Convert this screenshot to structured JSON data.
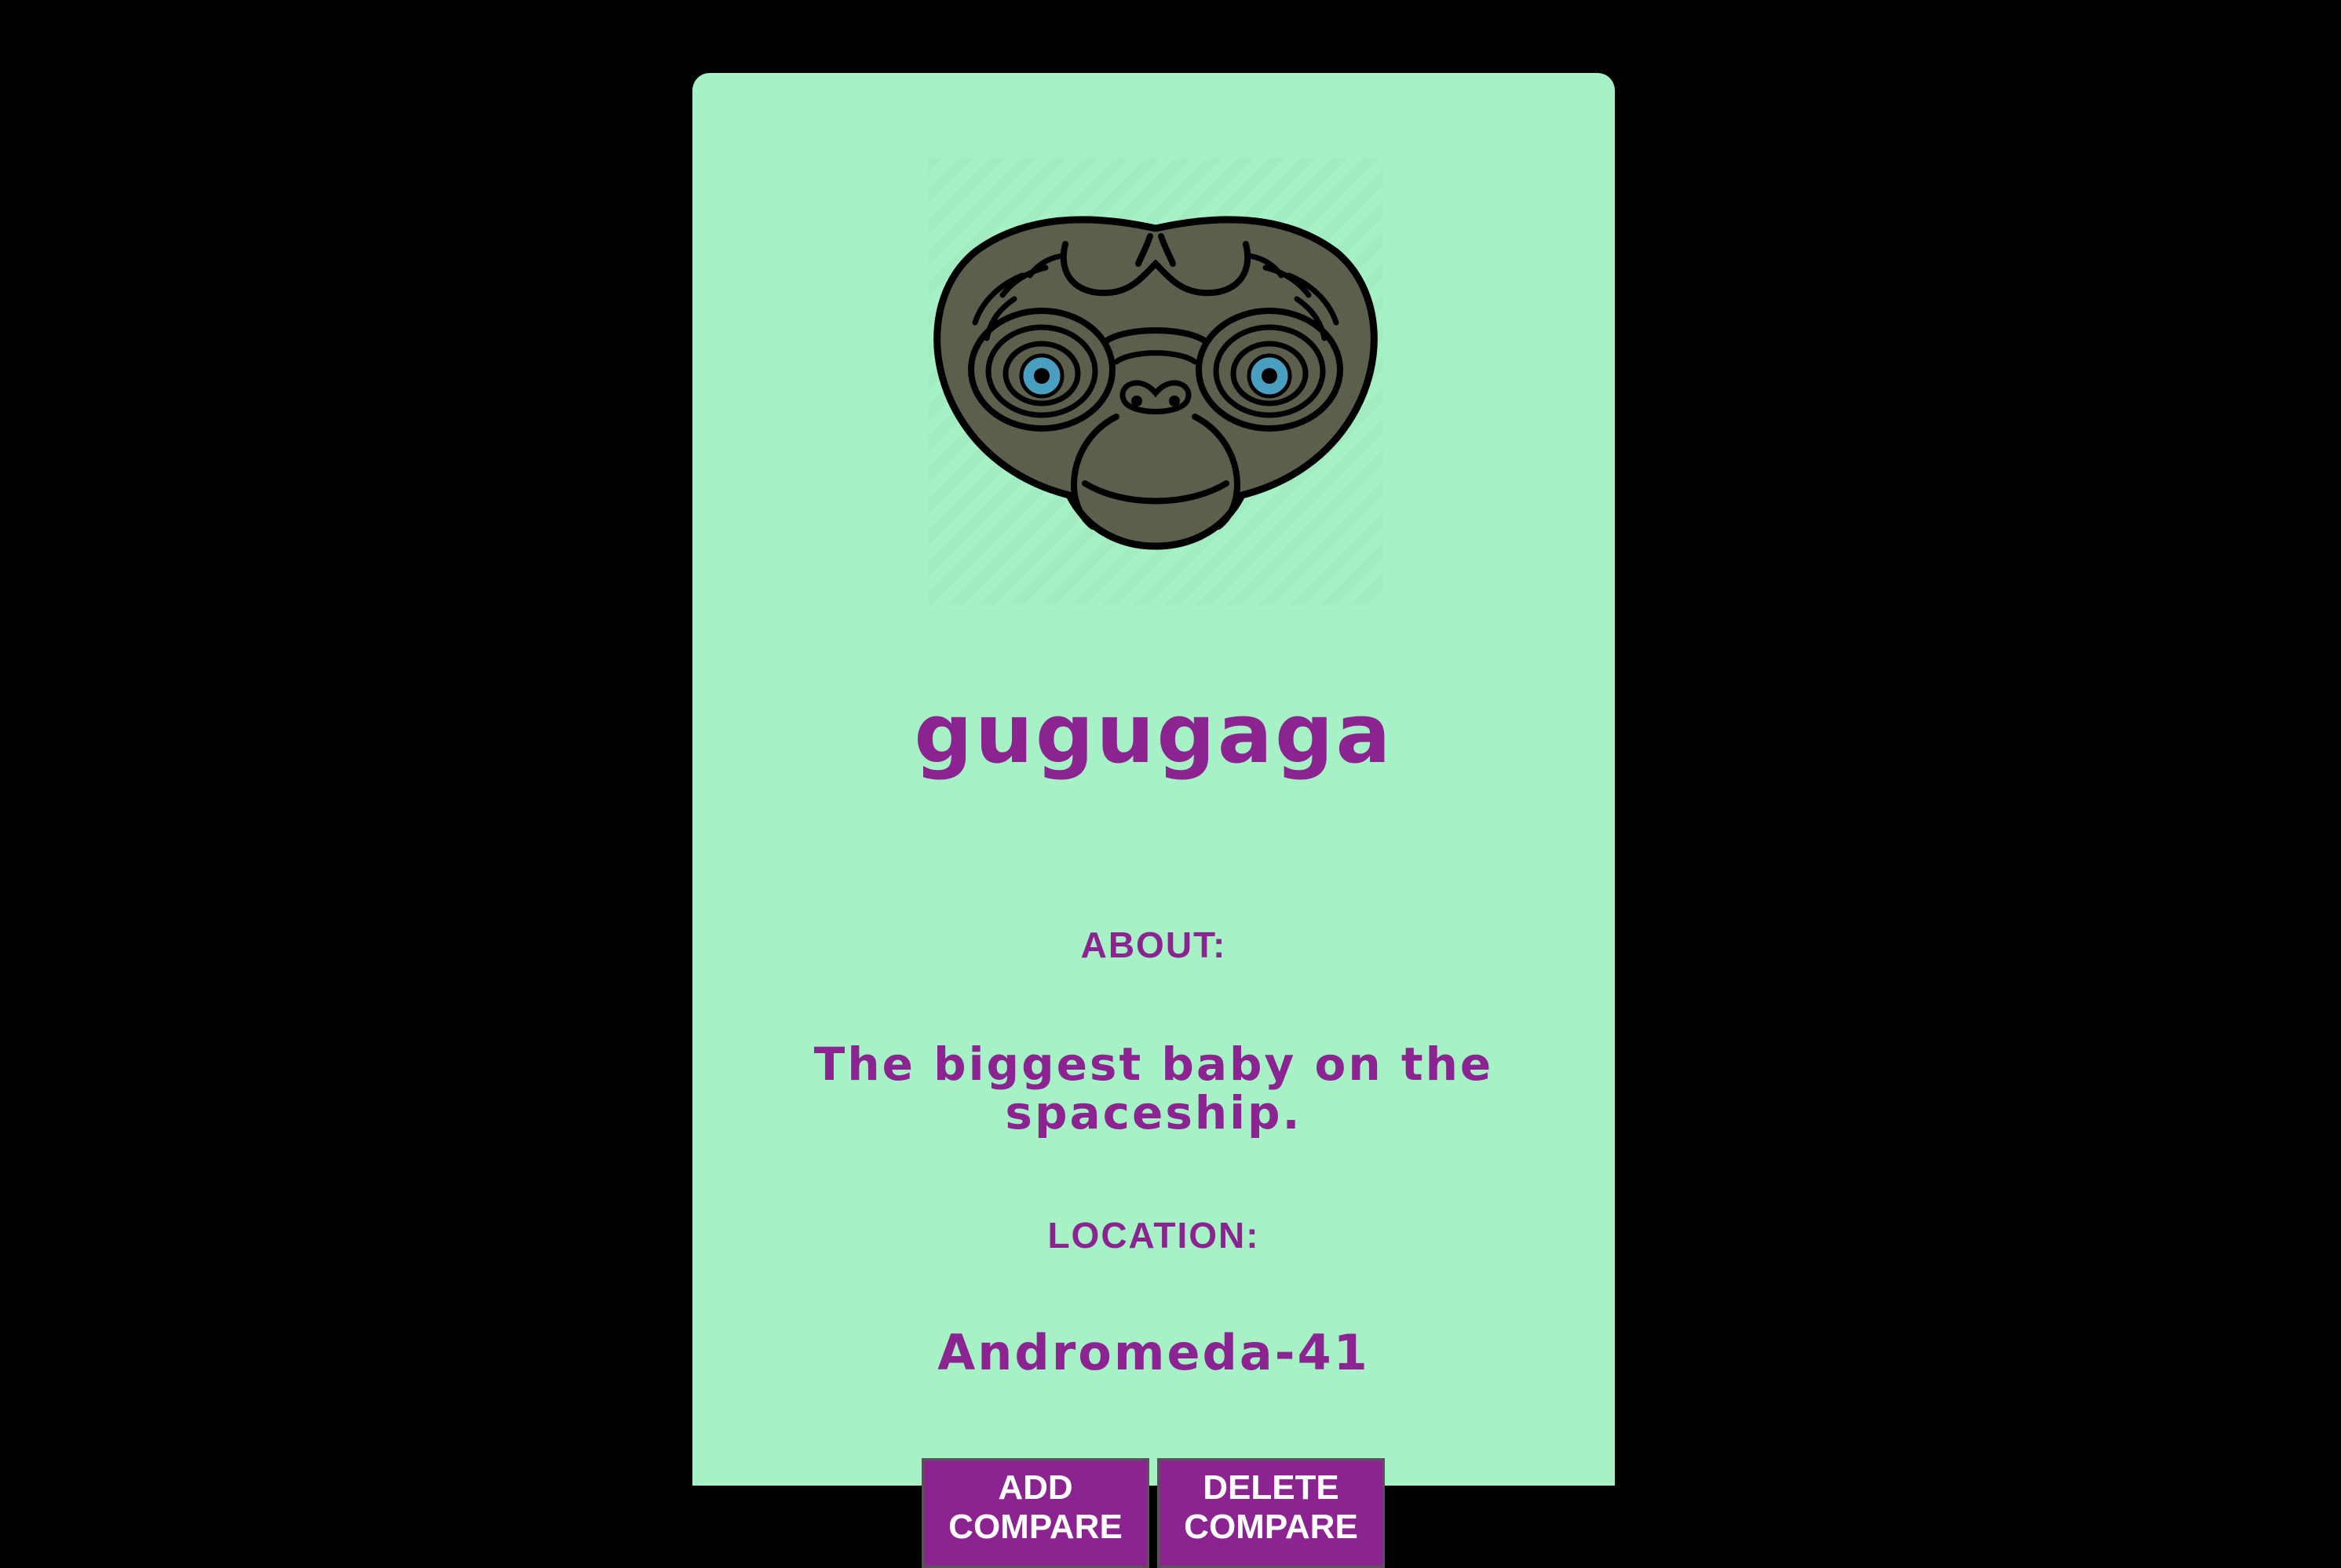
{
  "profile": {
    "name": "gugugaga",
    "about_label": "About:",
    "about_text": "The biggest baby on the spaceship.",
    "location_label": "Location:",
    "location_text": "Andromeda-41",
    "avatar_icon": "alien-face-icon"
  },
  "actions": {
    "add_label": "Add Compare",
    "delete_label": "Delete Compare"
  },
  "colors": {
    "background": "#000000",
    "card": "#a7f1c6",
    "accent": "#8b2390",
    "alien_skin": "#5e5e4d",
    "eye_iris": "#4a9fc0"
  }
}
